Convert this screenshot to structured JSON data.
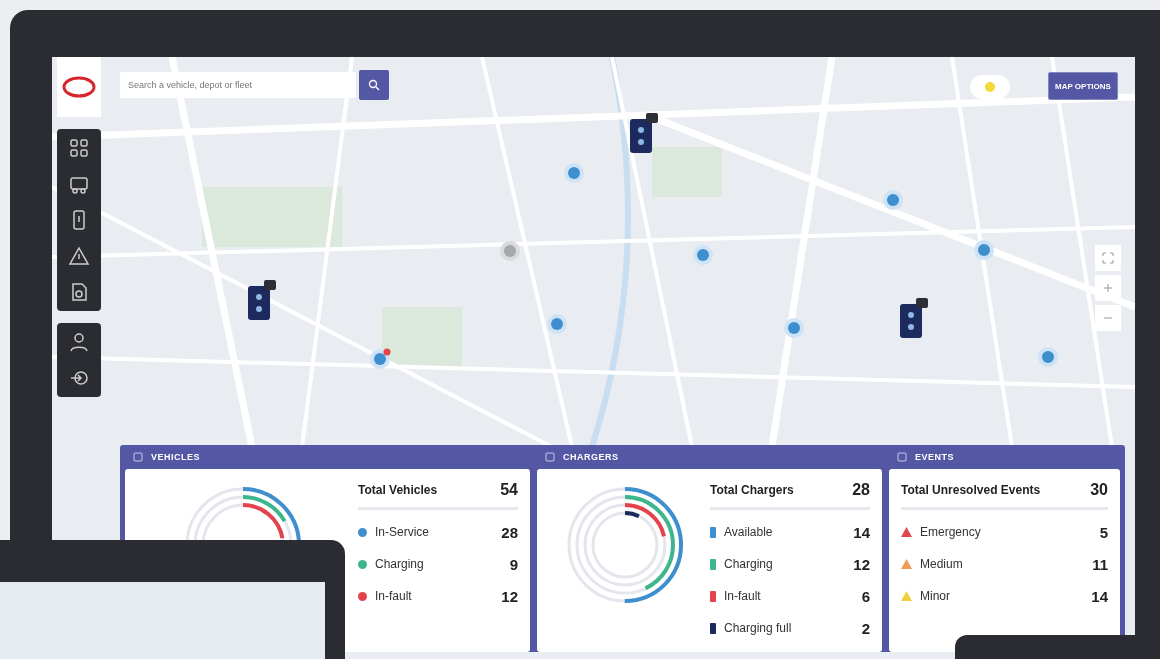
{
  "search": {
    "placeholder": "Search a vehicle, depot or fleet"
  },
  "map_options_button": "MAP OPTIONS",
  "panels": [
    {
      "title": "VEHICLES",
      "kind": "rings",
      "total_label": "Total Vehicles",
      "total": "54",
      "items": [
        {
          "kind": "dot",
          "label": "In-Service",
          "value": "28",
          "color": "#3f8fcf"
        },
        {
          "kind": "dot",
          "label": "Charging",
          "value": "9",
          "color": "#3cb68a"
        },
        {
          "kind": "dot",
          "label": "In-fault",
          "value": "12",
          "color": "#e5434b"
        }
      ]
    },
    {
      "title": "CHARGERS",
      "kind": "rings",
      "total_label": "Total Chargers",
      "total": "28",
      "items": [
        {
          "kind": "bar",
          "label": "Available",
          "value": "14",
          "color": "#3f8fcf"
        },
        {
          "kind": "bar",
          "label": "Charging",
          "value": "12",
          "color": "#3cb68a"
        },
        {
          "kind": "bar",
          "label": "In-fault",
          "value": "6",
          "color": "#e5434b"
        },
        {
          "kind": "bar",
          "label": "Charging full",
          "value": "2",
          "color": "#1c2a5e"
        }
      ]
    },
    {
      "title": "EVENTS",
      "kind": "list",
      "total_label": "Total Unresolved Events",
      "total": "30",
      "items": [
        {
          "kind": "triangle",
          "label": "Emergency",
          "value": "5",
          "color": "#e0474c"
        },
        {
          "kind": "triangle",
          "label": "Medium",
          "value": "11",
          "color": "#ef9a55"
        },
        {
          "kind": "triangle",
          "label": "Minor",
          "value": "14",
          "color": "#efd23e"
        }
      ]
    }
  ]
}
